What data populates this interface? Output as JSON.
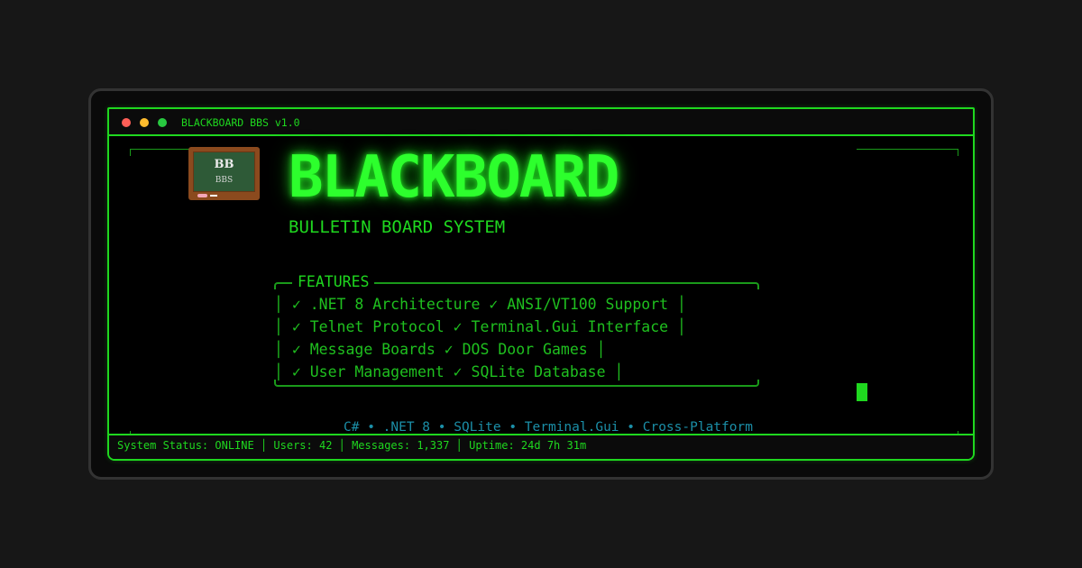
{
  "window": {
    "title": "BLACKBOARD BBS v1.0"
  },
  "logo": {
    "big": "BB",
    "small": "BBS"
  },
  "header": {
    "brand": "BLACKBOARD",
    "subtitle": "BULLETIN BOARD SYSTEM"
  },
  "features": {
    "label": "FEATURES",
    "lines": [
      "│ ✓ .NET 8 Architecture ✓ ANSI/VT100 Support │",
      "│ ✓ Telnet Protocol ✓ Terminal.Gui Interface │",
      "│ ✓ Message Boards ✓ DOS Door Games │",
      "│ ✓ User Management ✓ SQLite Database │"
    ]
  },
  "tech_line": "C# • .NET 8 • SQLite • Terminal.Gui • Cross-Platform",
  "status": {
    "text": "System Status: ONLINE │ Users: 42 │ Messages: 1,337 │ Uptime: 24d 7h 31m"
  },
  "colors": {
    "accent": "#1fd81f",
    "tech": "#1b8fa8",
    "background": "#000000"
  }
}
